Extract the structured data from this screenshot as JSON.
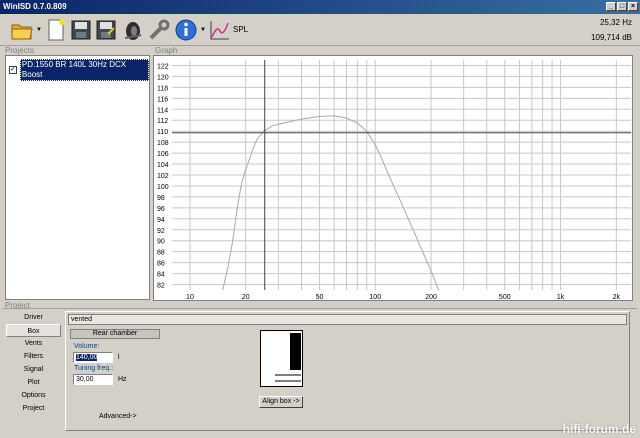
{
  "window": {
    "title": "WinISD 0.7.0.809"
  },
  "toolbar": {
    "buttons": [
      "open-folder-icon",
      "new-document-icon",
      "save-icon",
      "save-as-icon",
      "driver-editor-icon",
      "tools-icon",
      "info-icon",
      "spl-chart-icon"
    ],
    "spl_label": "SPL"
  },
  "readout": {
    "frequency": "25,32 Hz",
    "level": "109,714 dB"
  },
  "projects": {
    "label": "Projects",
    "items": [
      {
        "name": "PD.1550 BR 140L 30Hz DCX Boost",
        "checked": true
      }
    ]
  },
  "graph": {
    "label": "Graph",
    "y_ticks": [
      "122",
      "120",
      "118",
      "116",
      "114",
      "112",
      "110",
      "108",
      "106",
      "104",
      "102",
      "100",
      "98",
      "96",
      "94",
      "92",
      "90",
      "88",
      "86",
      "84",
      "82"
    ],
    "x_ticks": [
      "10",
      "20",
      "50",
      "100",
      "200",
      "500",
      "1k",
      "2k"
    ],
    "cursor": {
      "frequency_hz": 25.32,
      "level_db": 109.714
    }
  },
  "chart_data": {
    "type": "line",
    "title": "",
    "xlabel": "",
    "ylabel": "",
    "x_scale": "log",
    "xlim": [
      8,
      2400
    ],
    "ylim": [
      81,
      123
    ],
    "grid": true,
    "series": [
      {
        "x": [
          15,
          16,
          17,
          18,
          19,
          20,
          21,
          22,
          23,
          25,
          28,
          32,
          40,
          50,
          60,
          70,
          80,
          90,
          100,
          110,
          120,
          140,
          160,
          180,
          200,
          220
        ],
        "y": [
          81,
          85,
          90,
          96,
          100.5,
          103,
          105,
          107,
          108.5,
          110,
          111,
          111.5,
          112.2,
          112.7,
          112.8,
          112.4,
          111.5,
          110,
          107.5,
          104.5,
          101.5,
          96.5,
          92,
          88,
          84.5,
          81
        ]
      }
    ]
  },
  "project_panel": {
    "label": "Project",
    "tabs": [
      "Driver",
      "Box",
      "Vents",
      "Filters",
      "Signal",
      "Plot",
      "Options",
      "Project"
    ],
    "active_tab": "Box",
    "box_type": "vented",
    "chamber": "Rear chamber",
    "volume": {
      "label": "Volume:",
      "value": "140,00",
      "unit": "l"
    },
    "tuning": {
      "label": "Tuning freq.:",
      "value": "30,00",
      "unit": "Hz"
    },
    "advanced_label": "Advanced->",
    "align_label": "Align box ->"
  },
  "watermark": "hifi-forum.de"
}
